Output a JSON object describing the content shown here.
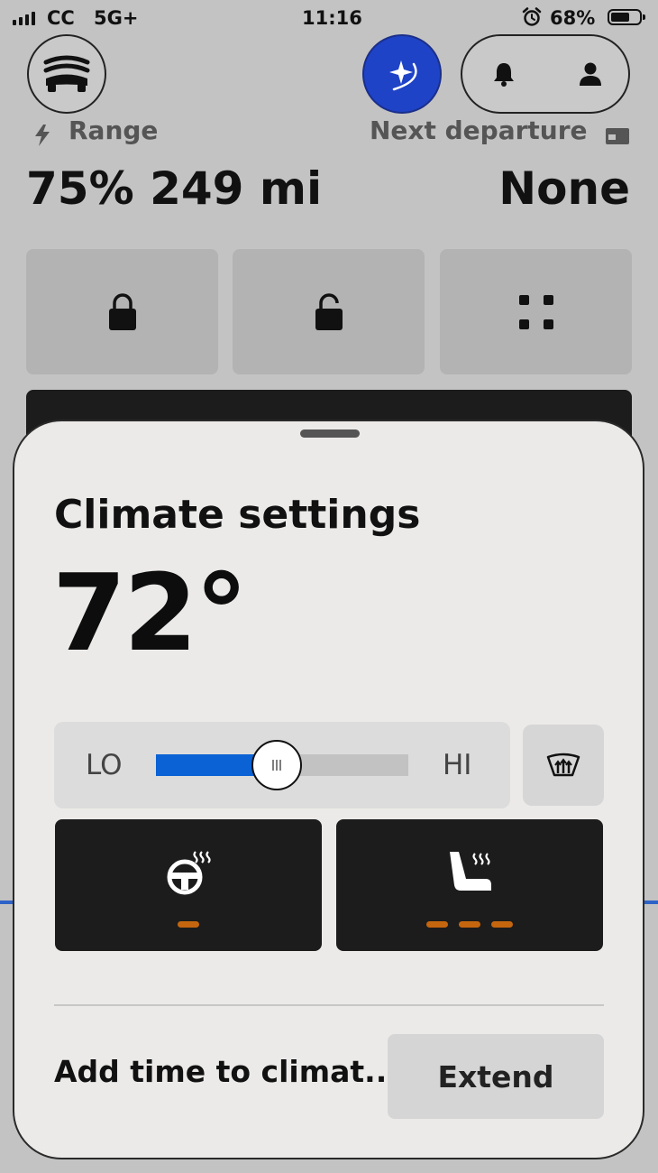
{
  "status_bar": {
    "carrier": "CC",
    "network": "5G+",
    "time": "11:16",
    "battery_percent": "68%",
    "battery_level": 0.68
  },
  "header": {
    "car_icon": "car-icon",
    "assistant_icon": "sparkle-icon",
    "notifications_icon": "bell-icon",
    "profile_icon": "person-icon"
  },
  "summary": {
    "range_label": "Range",
    "range_value": "75% 249 mi",
    "departure_label": "Next departure",
    "departure_value": "None"
  },
  "quick_actions": [
    {
      "icon": "lock-icon"
    },
    {
      "icon": "unlock-icon"
    },
    {
      "icon": "grid-icon"
    }
  ],
  "climate": {
    "title": "Climate settings",
    "temperature": "72°",
    "slider": {
      "low_label": "LO",
      "high_label": "HI",
      "level": 0.48
    },
    "heated_steering": {
      "icon": "heated-steering-wheel-icon",
      "level": 1,
      "max_level": 3
    },
    "heated_seat": {
      "icon": "heated-seat-icon",
      "level": 3,
      "max_level": 3
    },
    "defrost_icon": "rear-defrost-icon",
    "add_time_label": "Add time to climat...",
    "extend_label": "Extend"
  },
  "colors": {
    "accent": "#0a62d4",
    "assistant": "#1f43c7",
    "heat_indicator": "#c5660f",
    "dark_tile": "#1c1c1c"
  }
}
